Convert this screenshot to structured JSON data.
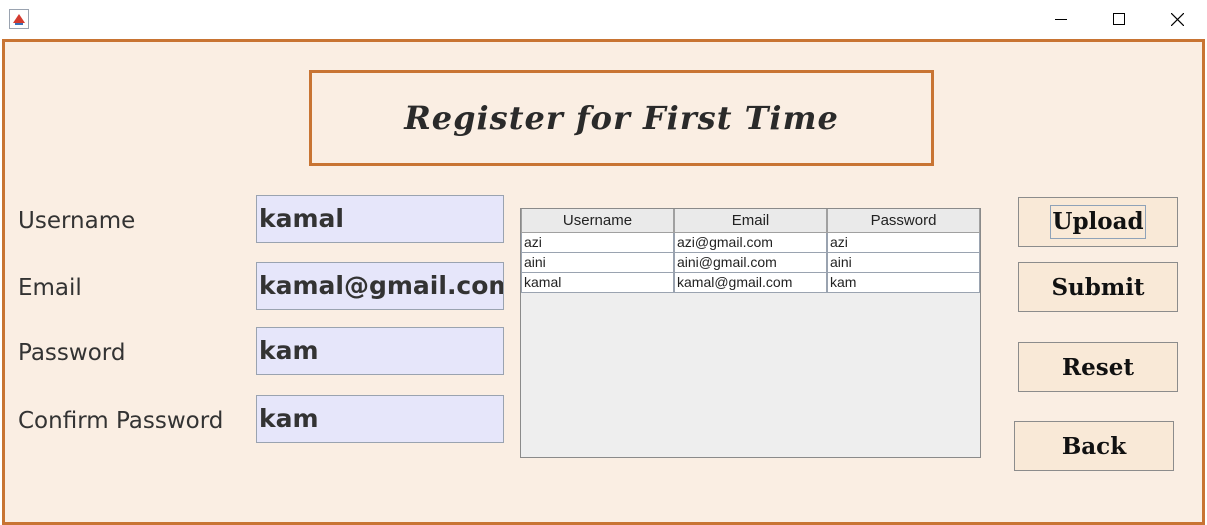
{
  "window": {
    "icon": "java-app-icon",
    "controls": [
      "minimize-icon",
      "maximize-icon",
      "close-icon"
    ]
  },
  "title": "Register for First Time",
  "form": {
    "username_label": "Username",
    "username_value": "kamal",
    "email_label": "Email",
    "email_value": "kamal@gmail.com",
    "password_label": "Password",
    "password_value": "kam",
    "confirm_label": "Confirm Password",
    "confirm_value": "kam"
  },
  "table": {
    "headers": [
      "Username",
      "Email",
      "Password"
    ],
    "rows": [
      [
        "azi",
        "azi@gmail.com",
        "azi"
      ],
      [
        "aini",
        "aini@gmail.com",
        "aini"
      ],
      [
        "kamal",
        "kamal@gmail.com",
        "kam"
      ]
    ]
  },
  "buttons": {
    "upload": "Upload",
    "submit": "Submit",
    "reset": "Reset",
    "back": "Back"
  },
  "colors": {
    "frame_bg": "#faeee3",
    "border": "#c87433",
    "field_bg": "#e6e6fa",
    "button_bg": "#f9e9d7"
  }
}
